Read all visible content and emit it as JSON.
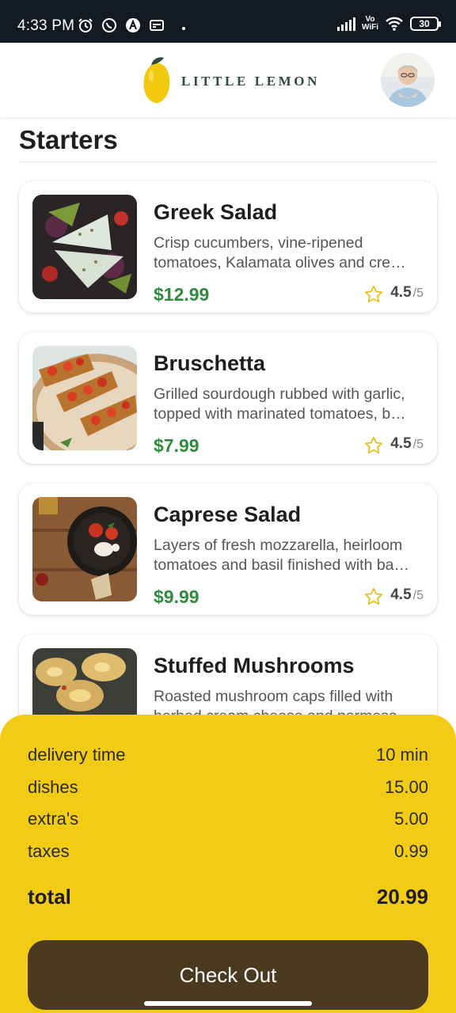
{
  "status_bar": {
    "time": "4:33 PM",
    "vowifi_top": "Vo",
    "vowifi_bottom": "WiFi",
    "battery": "30"
  },
  "header": {
    "brand": "LITTLE LEMON"
  },
  "section": {
    "title": "Starters"
  },
  "menu_items": [
    {
      "name": "Greek Salad",
      "desc_line1": "Crisp cucumbers, vine-ripened",
      "desc_line2": "tomatoes, Kalamata olives and cre…",
      "price": "$12.99",
      "rating": "4.5",
      "rating_max": "/5"
    },
    {
      "name": "Bruschetta",
      "desc_line1": "Grilled sourdough rubbed with garlic,",
      "desc_line2": "topped with marinated tomatoes, b…",
      "price": "$7.99",
      "rating": "4.5",
      "rating_max": "/5"
    },
    {
      "name": "Caprese Salad",
      "desc_line1": "Layers of fresh mozzarella, heirloom",
      "desc_line2": "tomatoes and basil finished with ba…",
      "price": "$9.99",
      "rating": "4.5",
      "rating_max": "/5"
    },
    {
      "name": "Stuffed Mushrooms",
      "desc_line1": "Roasted mushroom caps filled with",
      "desc_line2": "herbed cream cheese and parmesa…"
    }
  ],
  "summary": {
    "delivery_label": "delivery time",
    "delivery_value": "10 min",
    "dishes_label": "dishes",
    "dishes_value": "15.00",
    "extras_label": "extra's",
    "extras_value": "5.00",
    "taxes_label": "taxes",
    "taxes_value": "0.99",
    "total_label": "total",
    "total_value": "20.99",
    "checkout_label": "Check Out"
  },
  "colors": {
    "accent_yellow": "#f2cb14",
    "price_green": "#2e8b3d",
    "checkout_brown": "#4a3a20",
    "status_bar": "#141a24"
  }
}
